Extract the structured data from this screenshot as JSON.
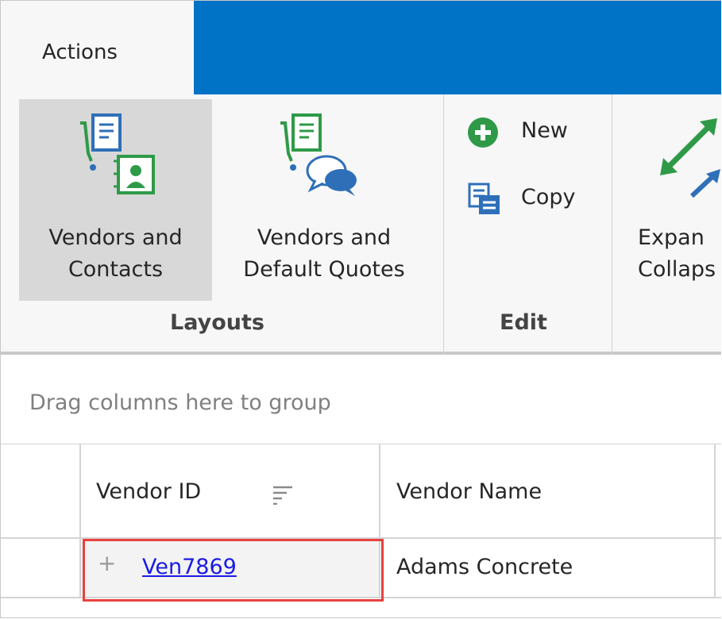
{
  "tabs": [
    {
      "label": "Actions",
      "active": true
    }
  ],
  "ribbon": {
    "groups": [
      {
        "label": "Layouts",
        "buttons": [
          {
            "label_line1": "Vendors and",
            "label_line2": "Contacts",
            "icon": "vendors-contacts-icon",
            "selected": true
          },
          {
            "label_line1": "Vendors and",
            "label_line2": "Default Quotes",
            "icon": "vendors-quotes-icon",
            "selected": false
          }
        ]
      },
      {
        "label": "Edit",
        "buttons": [
          {
            "label": "New",
            "icon": "plus-circle-icon"
          },
          {
            "label": "Copy",
            "icon": "copy-icon"
          }
        ]
      },
      {
        "label": "",
        "buttons": [
          {
            "label_line1": "Expan",
            "label_line2": "Collaps",
            "icon": "expand-collapse-icon"
          }
        ]
      }
    ]
  },
  "group_panel": {
    "hint": "Drag columns here to group"
  },
  "grid": {
    "columns": [
      {
        "header": "Vendor ID",
        "sort_icon": "sort-icon"
      },
      {
        "header": "Vendor Name"
      }
    ],
    "rows": [
      {
        "expander": "+",
        "vendor_id": "Ven7869",
        "vendor_name": "Adams Concrete"
      }
    ]
  },
  "colors": {
    "tab_strip": "#0073c6",
    "highlight": "#e8413e",
    "link": "#1a1ae6",
    "icon_green": "#2e9a47",
    "icon_blue": "#2f6fb8"
  }
}
